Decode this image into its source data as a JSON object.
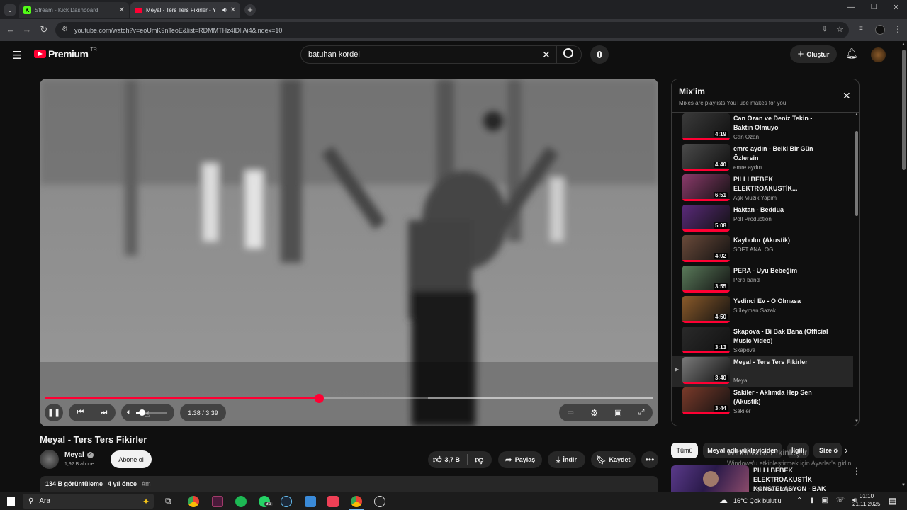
{
  "browser": {
    "tabs": [
      {
        "title": "Stream - Kick Dashboard",
        "active": false
      },
      {
        "title": "Meyal - Ters Ters Fikirler - Y",
        "active": true
      }
    ],
    "url": "youtube.com/watch?v=eoUmK9nTeoE&list=RDMMTHz4lDlIAi4&index=10"
  },
  "header": {
    "logo": "Premium",
    "region": "TR",
    "search_value": "batuhan kordel",
    "create_label": "Oluştur"
  },
  "player": {
    "time": "1:38 / 3:39",
    "progress": 0.45,
    "buffered_start": 0.63
  },
  "video": {
    "title": "Meyal - Ters Ters Fikirler",
    "channel": "Meyal",
    "subscribers": "1,92 B abone",
    "subscribe_label": "Abone ol",
    "likes": "3,7 B",
    "share_label": "Paylaş",
    "download_label": "İndir",
    "save_label": "Kaydet",
    "views": "134 B görüntüleme",
    "age": "4 yıl önce",
    "hashtag": "#m"
  },
  "mix": {
    "title": "Mix'im",
    "subtitle": "Mixes are playlists YouTube makes for you",
    "items": [
      {
        "title": "Can Ozan ve Deniz Tekin - Baktın Olmuyo",
        "channel": "Can Ozan",
        "duration": "4:19",
        "color": "#3a3a3a",
        "active": false
      },
      {
        "title": "emre aydın - Belki Bir Gün Özlersin",
        "channel": "emre aydın",
        "duration": "4:40",
        "color": "#4a4a4a",
        "active": false
      },
      {
        "title": "PİLLİ BEBEK ELEKTROAKUSTİK...",
        "channel": "Aşk Müzik Yapım",
        "duration": "6:51",
        "color": "#8a3a6a",
        "active": false
      },
      {
        "title": "Haktan - Beddua",
        "channel": "Poll Production",
        "duration": "5:08",
        "color": "#5a2a7a",
        "active": false
      },
      {
        "title": "Kaybolur (Akustik)",
        "channel": "SOFT ANALOG",
        "duration": "4:02",
        "color": "#6a4a3a",
        "active": false
      },
      {
        "title": "PERA - Uyu Bebeğim",
        "channel": "Pera band",
        "duration": "3:55",
        "color": "#5a7a5a",
        "active": false
      },
      {
        "title": "Yedinci Ev - O Olmasa",
        "channel": "Süleyman Sazak",
        "duration": "4:50",
        "color": "#8a5a2a",
        "active": false
      },
      {
        "title": "Skapova - Bi Bak Bana (Official Music Video)",
        "channel": "Skapova",
        "duration": "3:13",
        "color": "#2a2a2a",
        "active": false
      },
      {
        "title": "Meyal - Ters Ters Fikirler",
        "channel": "Meyal",
        "duration": "3:40",
        "color": "#7a7a7a",
        "active": true
      },
      {
        "title": "Sakiler - Aklımda Hep Sen (Akustik)",
        "channel": "Sakiler",
        "duration": "3:44",
        "color": "#7a3a2a",
        "active": false
      }
    ]
  },
  "chips": [
    "Tümü",
    "Meyal adlı yükleyiciden",
    "İlgili",
    "Size ö"
  ],
  "recommend": {
    "title": "PİLLİ BEBEK ELEKTROAKUSTİK KONSTELASYON - BAK",
    "channel": "Aşk Müzik Yapım"
  },
  "watermark": {
    "line1": "Windows'u Etkinleştir",
    "line2": "Windows'u etkinleştirmek için Ayarlar'a gidin."
  },
  "taskbar": {
    "search_placeholder": "Ara",
    "whatsapp_badge": "35",
    "weather": "16°C  Çok bulutlu",
    "time": "01:10",
    "date": "21.11.2025"
  }
}
